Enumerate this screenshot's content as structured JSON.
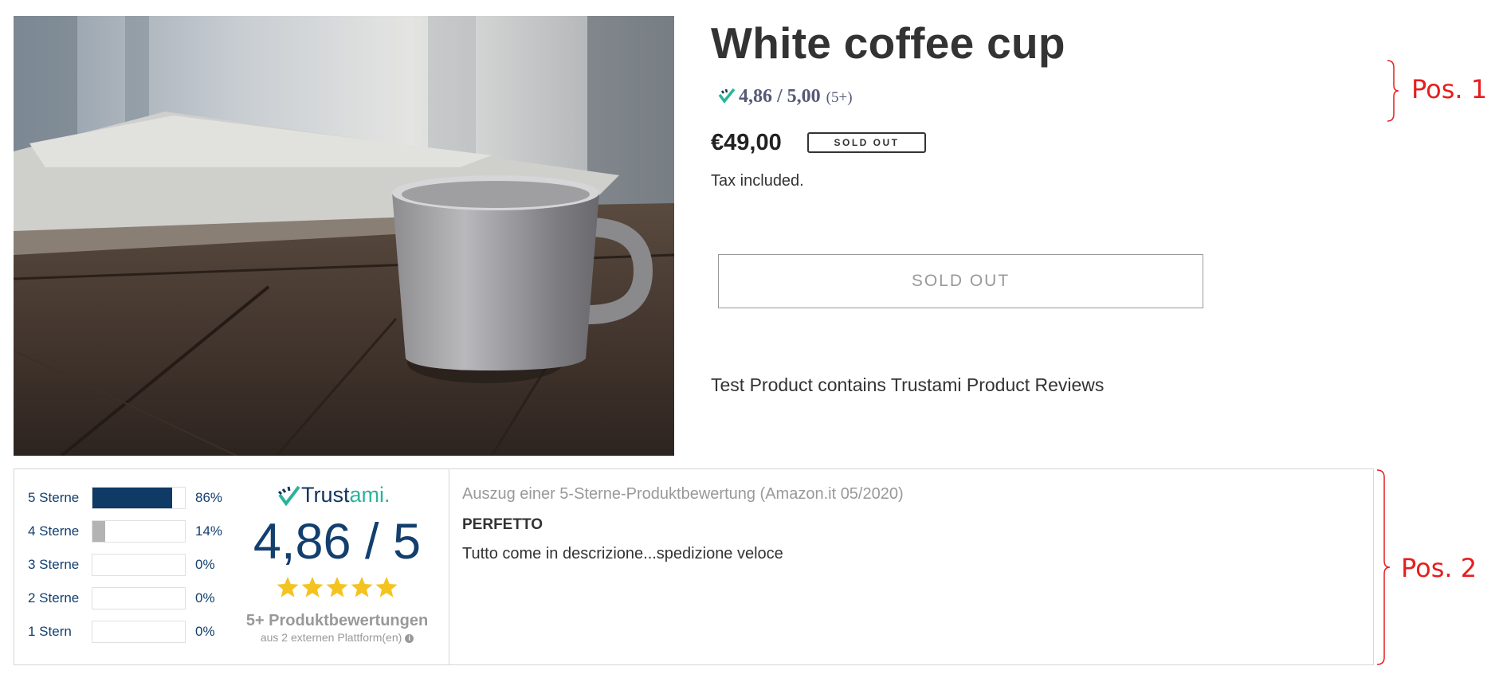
{
  "product": {
    "title": "White coffee cup",
    "rating_score": "4,86 / 5,00",
    "rating_count": "(5+)",
    "price": "€49,00",
    "badge": "SOLD OUT",
    "tax_note": "Tax included.",
    "button_label": "SOLD OUT",
    "description": "Test Product contains Trustami Product Reviews"
  },
  "annotations": {
    "pos1": "Pos. 1",
    "pos2": "Pos. 2",
    "color": "#e61e1e"
  },
  "widget": {
    "distribution": [
      {
        "label": "5 Sterne",
        "percent": 86,
        "percent_text": "86%",
        "color": "#0f3a66"
      },
      {
        "label": "4 Sterne",
        "percent": 14,
        "percent_text": "14%",
        "color": "#b3b3b3"
      },
      {
        "label": "3 Sterne",
        "percent": 0,
        "percent_text": "0%",
        "color": "#b3b3b3"
      },
      {
        "label": "2 Sterne",
        "percent": 0,
        "percent_text": "0%",
        "color": "#b3b3b3"
      },
      {
        "label": "1 Stern",
        "percent": 0,
        "percent_text": "0%",
        "color": "#b3b3b3"
      }
    ],
    "logo_part1": "Trust",
    "logo_part2": "ami.",
    "score": "4,86 / 5",
    "stars": 5,
    "star_color": "#f4c31f",
    "review_count": "5+ Produktbewertungen",
    "platforms": "aus 2 externen Plattform(en)",
    "info_icon": "i",
    "excerpt_header": "Auszug einer 5-Sterne-Produktbewertung (Amazon.it 05/2020)",
    "review_title": "PERFETTO",
    "review_text": "Tutto come in descrizione...spedizione veloce"
  }
}
